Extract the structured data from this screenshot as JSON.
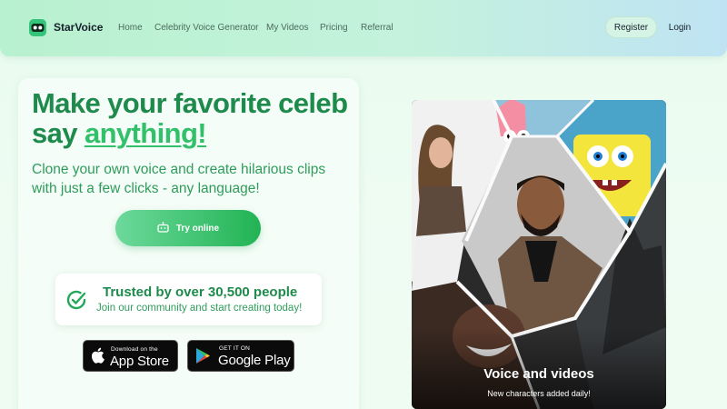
{
  "header": {
    "brand": "StarVoice",
    "nav": [
      "Home",
      "Celebrity Voice Generator",
      "My Videos",
      "Pricing",
      "Referral"
    ],
    "register_label": "Register",
    "login_label": "Login"
  },
  "hero": {
    "headline_line1": "Make your favorite celeb",
    "headline_prefix": "say ",
    "headline_accent": "anything!",
    "subtext": "Clone your own voice and create hilarious clips with just a few clicks - any language!",
    "cta_label": "Try online"
  },
  "trust": {
    "title": "Trusted by over 30,500 people",
    "subtitle": "Join our community and start creating today!"
  },
  "stores": {
    "apple_small": "Download on the",
    "apple_big": "App Store",
    "google_small": "GET IT ON",
    "google_big": "Google Play"
  },
  "panel": {
    "title": "Voice and videos",
    "subtitle": "New characters added daily!"
  },
  "colors": {
    "brand_green": "#34c47a",
    "headline_green": "#1e8a4b",
    "accent_green": "#33c06a"
  },
  "icons": [
    "logo-mask-icon",
    "robot-icon",
    "check-circle-icon",
    "apple-icon",
    "google-play-icon"
  ]
}
